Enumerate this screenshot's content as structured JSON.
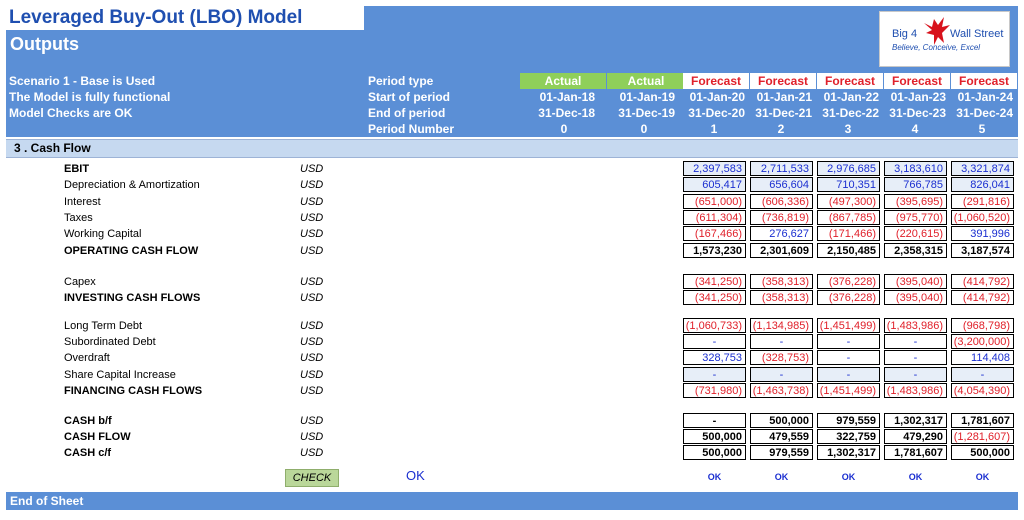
{
  "header": {
    "title": "Leveraged Buy-Out (LBO) Model",
    "subtitle": "Outputs",
    "status_lines": [
      "Scenario 1 - Base is Used",
      "The Model is fully functional",
      "Model Checks are OK"
    ],
    "period_labels": [
      "Period type",
      "Start of period",
      "End of period",
      "Period Number"
    ]
  },
  "logo": {
    "left_text": "Big 4",
    "right_text": "Wall Street",
    "tagline": "Believe, Conceive, Excel"
  },
  "periods": [
    {
      "type": "Actual",
      "start": "01-Jan-18",
      "end": "31-Dec-18",
      "number": "0"
    },
    {
      "type": "Actual",
      "start": "01-Jan-19",
      "end": "31-Dec-19",
      "number": "0"
    },
    {
      "type": "Forecast",
      "start": "01-Jan-20",
      "end": "31-Dec-20",
      "number": "1"
    },
    {
      "type": "Forecast",
      "start": "01-Jan-21",
      "end": "31-Dec-21",
      "number": "2"
    },
    {
      "type": "Forecast",
      "start": "01-Jan-22",
      "end": "31-Dec-22",
      "number": "3"
    },
    {
      "type": "Forecast",
      "start": "01-Jan-23",
      "end": "31-Dec-23",
      "number": "4"
    },
    {
      "type": "Forecast",
      "start": "01-Jan-24",
      "end": "31-Dec-24",
      "number": "5"
    }
  ],
  "colors": {
    "band": "#5b8fd6",
    "actual": "#8fcf5a",
    "forecast": "#e0202a",
    "section": "#c6d9f0",
    "blue_value": "#1a2ed0"
  },
  "section_title": "3 . Cash Flow",
  "unit": "USD",
  "rows": [
    {
      "label": "EBIT",
      "bold": true,
      "style": "blue",
      "values": [
        "2,397,583",
        "2,711,533",
        "2,976,685",
        "3,183,610",
        "3,321,874"
      ]
    },
    {
      "label": "Depreciation & Amortization",
      "bold": false,
      "style": "blue",
      "values": [
        "605,417",
        "656,604",
        "710,351",
        "766,785",
        "826,041"
      ]
    },
    {
      "label": "Interest",
      "bold": false,
      "style": "red",
      "values": [
        "(651,000)",
        "(606,336)",
        "(497,300)",
        "(395,695)",
        "(291,816)"
      ]
    },
    {
      "label": "Taxes",
      "bold": false,
      "style": "red",
      "values": [
        "(611,304)",
        "(736,819)",
        "(867,785)",
        "(975,770)",
        "(1,060,520)"
      ]
    },
    {
      "label": "Working Capital",
      "bold": false,
      "style": "mixed",
      "values": [
        "(167,466)",
        "276,627",
        "(171,466)",
        "(220,615)",
        "391,996"
      ]
    },
    {
      "label": "OPERATING CASH FLOW",
      "bold": true,
      "style": "black",
      "values": [
        "1,573,230",
        "2,301,609",
        "2,150,485",
        "2,358,315",
        "3,187,574"
      ]
    },
    {
      "label": "Capex",
      "bold": false,
      "style": "red",
      "values": [
        "(341,250)",
        "(358,313)",
        "(376,228)",
        "(395,040)",
        "(414,792)"
      ]
    },
    {
      "label": "INVESTING CASH FLOWS",
      "bold": true,
      "style": "red",
      "values": [
        "(341,250)",
        "(358,313)",
        "(376,228)",
        "(395,040)",
        "(414,792)"
      ]
    },
    {
      "label": "Long Term Debt",
      "bold": false,
      "style": "red",
      "values": [
        "(1,060,733)",
        "(1,134,985)",
        "(1,451,499)",
        "(1,483,986)",
        "(968,798)"
      ]
    },
    {
      "label": "Subordinated Debt",
      "bold": false,
      "style": "mixed",
      "values": [
        "-",
        "-",
        "-",
        "-",
        "(3,200,000)"
      ]
    },
    {
      "label": "Overdraft",
      "bold": false,
      "style": "mixed",
      "values": [
        "328,753",
        "(328,753)",
        "-",
        "-",
        "114,408"
      ]
    },
    {
      "label": "Share Capital Increase",
      "bold": false,
      "style": "blue",
      "values": [
        "-",
        "-",
        "-",
        "-",
        "-"
      ]
    },
    {
      "label": "FINANCING CASH FLOWS",
      "bold": true,
      "style": "red",
      "values": [
        "(731,980)",
        "(1,463,738)",
        "(1,451,499)",
        "(1,483,986)",
        "(4,054,390)"
      ]
    },
    {
      "label": "CASH b/f",
      "bold": true,
      "style": "black",
      "values": [
        "-",
        "500,000",
        "979,559",
        "1,302,317",
        "1,781,607"
      ]
    },
    {
      "label": "CASH FLOW",
      "bold": true,
      "style": "mixed",
      "values": [
        "500,000",
        "479,559",
        "322,759",
        "479,290",
        "(1,281,607)"
      ]
    },
    {
      "label": "CASH c/f",
      "bold": true,
      "style": "black",
      "values": [
        "500,000",
        "979,559",
        "1,302,317",
        "1,781,607",
        "500,000"
      ]
    }
  ],
  "check": {
    "button_label": "CHECK",
    "overall": "OK",
    "per_period": [
      "OK",
      "OK",
      "OK",
      "OK",
      "OK"
    ]
  },
  "footer": "End of Sheet"
}
